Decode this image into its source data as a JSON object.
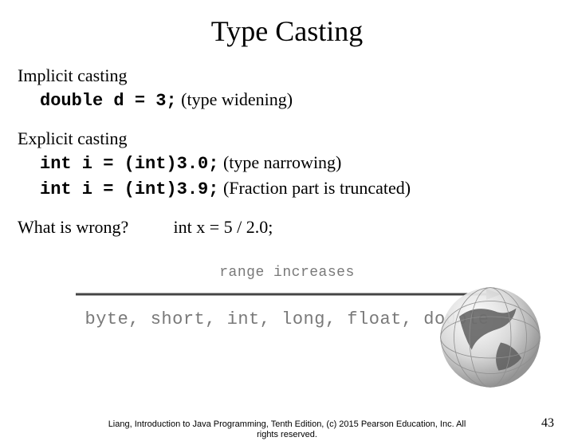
{
  "title": "Type Casting",
  "implicit": {
    "heading": "Implicit casting",
    "code": "double d = 3;",
    "note": " (type widening)"
  },
  "explicit": {
    "heading": "Explicit casting",
    "line1_code": "int i = (int)3.0;",
    "line1_note": " (type narrowing)",
    "line2_code": "int i = (int)3.9;",
    "line2_note": " (Fraction part is truncated)"
  },
  "wrong": {
    "question": "What is wrong?",
    "code": "int x = 5 / 2.0;"
  },
  "diagram": {
    "range_label": "range increases",
    "types": "byte, short, int, long, float, double"
  },
  "footer": {
    "line1": "Liang, Introduction to Java Programming, Tenth Edition, (c) 2015 Pearson Education, Inc. All",
    "line2": "rights reserved."
  },
  "page_number": "43"
}
